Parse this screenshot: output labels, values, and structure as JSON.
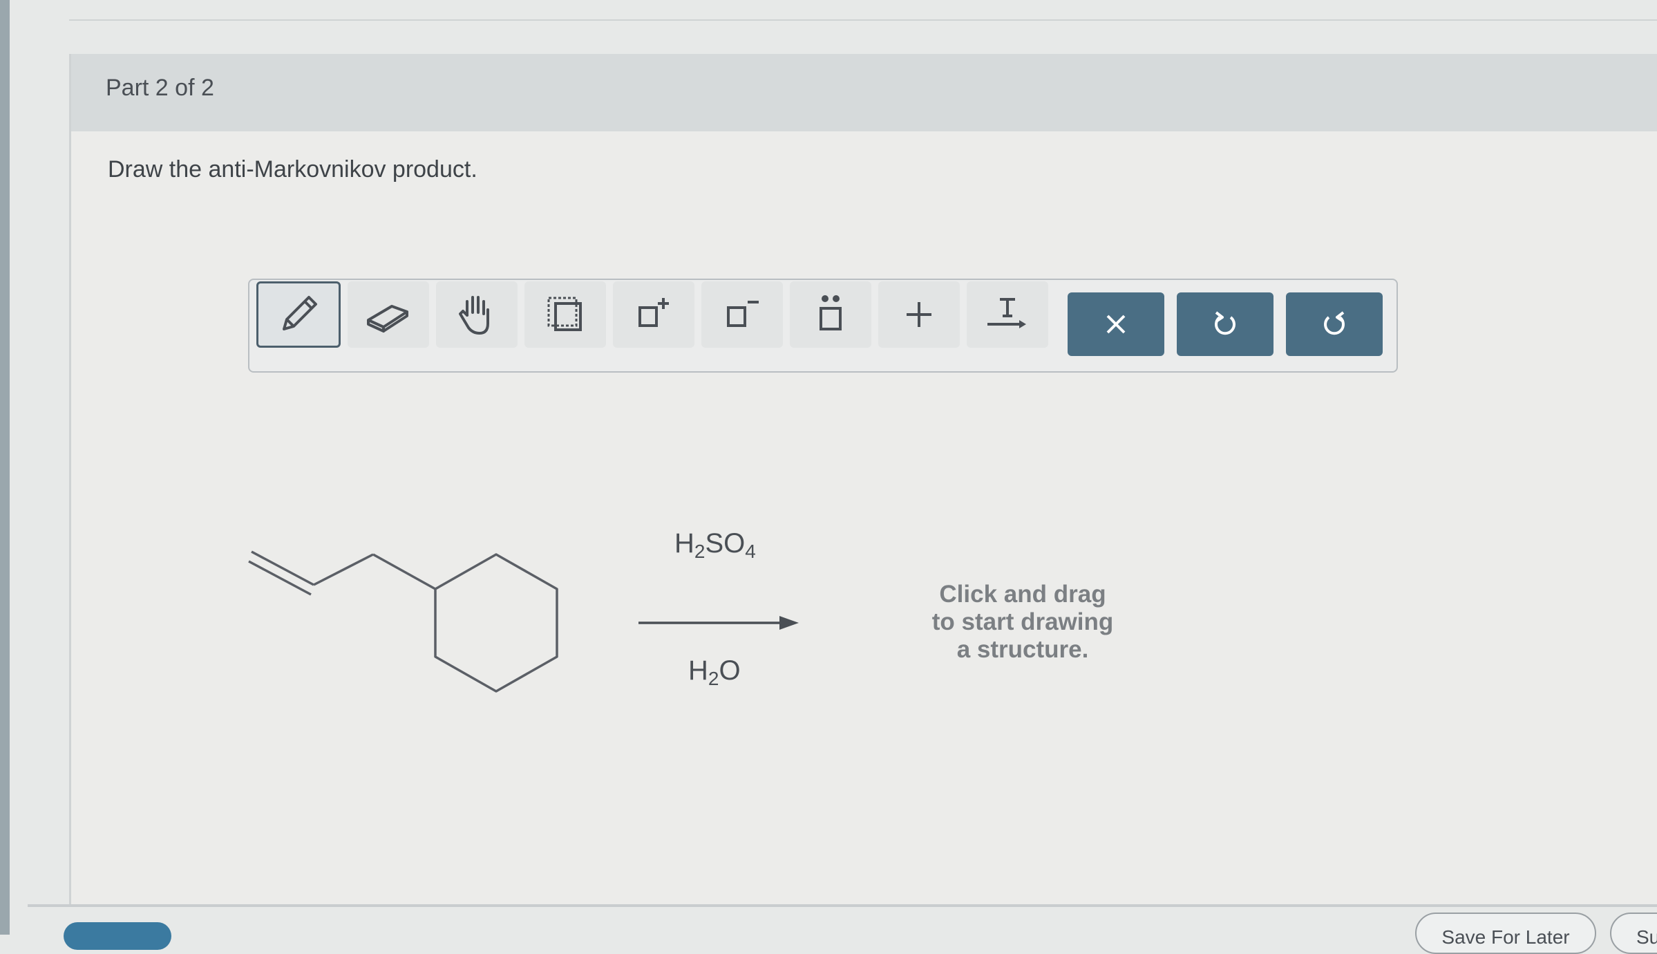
{
  "part": {
    "title": "Part 2 of 2"
  },
  "question": {
    "prompt": "Draw the anti-Markovnikov product."
  },
  "toolbar": {
    "tools": [
      {
        "name": "pencil-icon",
        "active": true
      },
      {
        "name": "eraser-icon",
        "active": false
      },
      {
        "name": "hand-icon",
        "active": false
      },
      {
        "name": "select-icon",
        "active": false
      },
      {
        "name": "positive-charge-icon",
        "active": false
      },
      {
        "name": "negative-charge-icon",
        "active": false
      },
      {
        "name": "lone-pair-icon",
        "active": false
      },
      {
        "name": "plus-icon",
        "active": false
      },
      {
        "name": "text-arrow-icon",
        "active": false
      }
    ],
    "actions": [
      {
        "name": "clear-icon"
      },
      {
        "name": "undo-icon"
      },
      {
        "name": "redo-icon"
      }
    ],
    "action_color": "#4a6e84"
  },
  "reaction": {
    "reagent_top": {
      "base": "H",
      "sub1": "2",
      "mid": "SO",
      "sub2": "4"
    },
    "reagent_bottom": {
      "base": "H",
      "sub1": "2",
      "end": "O"
    }
  },
  "canvas": {
    "hint_line1": "Click and drag",
    "hint_line2": "to start drawing",
    "hint_line3": "a structure."
  },
  "footer": {
    "save_label": "Save For Later",
    "submit_label": "Su"
  }
}
